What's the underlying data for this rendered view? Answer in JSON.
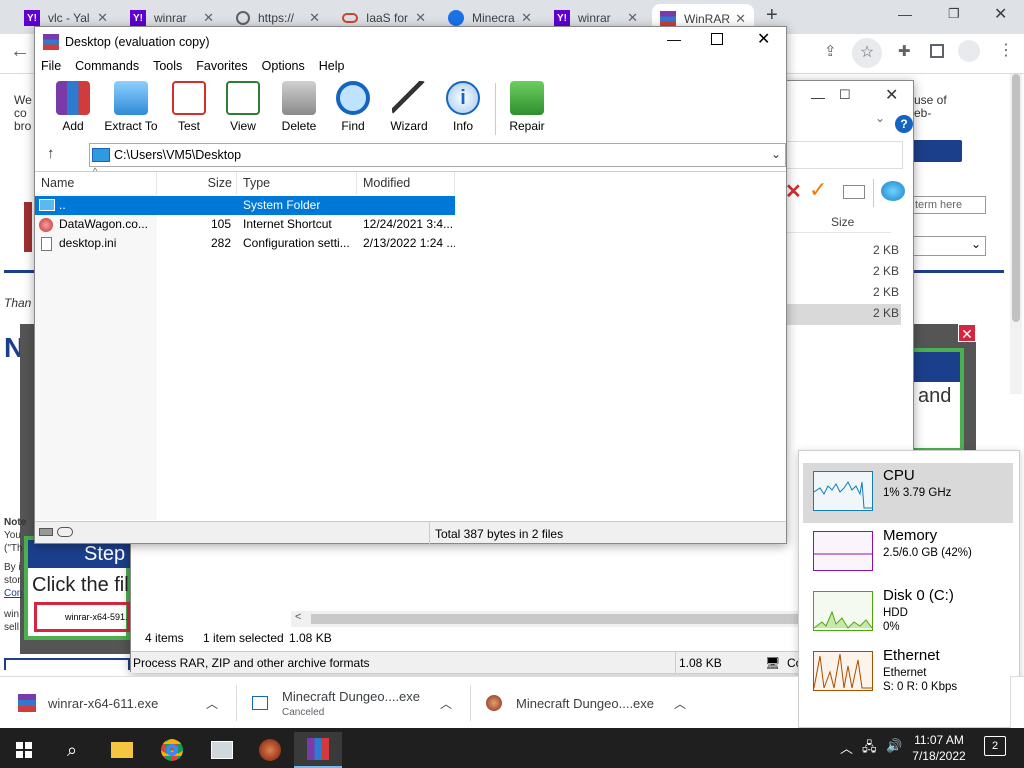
{
  "browser": {
    "tabs": [
      {
        "label": "vlc - Yal",
        "icon": "yahoo-icon"
      },
      {
        "label": "winrar",
        "icon": "yahoo-icon"
      },
      {
        "label": "https://",
        "icon": "globe-icon"
      },
      {
        "label": "IaaS for",
        "icon": "oracle-icon"
      },
      {
        "label": "Minecra",
        "icon": "edge-icon"
      },
      {
        "label": "winrar",
        "icon": "yahoo-icon"
      },
      {
        "label": "WinRAR",
        "icon": "winrar-icon"
      }
    ],
    "new_tab": "+"
  },
  "page_behind": {
    "left_texts": [
      "We",
      "co",
      "bro",
      "Than",
      "No"
    ],
    "side_texts": [
      "use of",
      "eb-"
    ],
    "search_placeholder": "term here",
    "promo_and": "and",
    "promo_e": "e",
    "step_title": "Step",
    "step_text": "Click the fil",
    "download_chip": "winrar-x64-591.e",
    "note_texts": [
      "Note",
      "You",
      "(\"Th",
      "By i",
      "stor",
      "Con",
      "win",
      "sell"
    ]
  },
  "winrar_main": {
    "title": "Desktop (evaluation copy)",
    "menu": [
      "File",
      "Commands",
      "Tools",
      "Favorites",
      "Options",
      "Help"
    ],
    "tools": [
      "Add",
      "Extract To",
      "Test",
      "View",
      "Delete",
      "Find",
      "Wizard",
      "Info",
      "Repair"
    ],
    "path": "C:\\Users\\VM5\\Desktop",
    "columns": [
      "Name",
      "Size",
      "Type",
      "Modified"
    ],
    "rows": [
      {
        "name": "..",
        "size": "",
        "type": "System Folder",
        "modified": ""
      },
      {
        "name": "DataWagon.co...",
        "size": "105",
        "type": "Internet Shortcut",
        "modified": "12/24/2021 3:4..."
      },
      {
        "name": "desktop.ini",
        "size": "282",
        "type": "Configuration setti...",
        "modified": "2/13/2022 1:24 ..."
      }
    ],
    "status": "Total 387 bytes in 2 files"
  },
  "winrar_back": {
    "size_header": "Size",
    "sizes": [
      "2 KB",
      "2 KB",
      "2 KB",
      "2 KB"
    ],
    "items_count": "4 items",
    "selected": "1 item selected",
    "selected_size": "1.08 KB",
    "status_left": "Process RAR, ZIP and other archive formats",
    "status_size": "1.08 KB",
    "status_right": "Co"
  },
  "task_manager": [
    {
      "name": "CPU",
      "line1": "1%  3.79 GHz",
      "line2": "",
      "color": "#117dbb"
    },
    {
      "name": "Memory",
      "line1": "2.5/6.0 GB (42%)",
      "line2": "",
      "color": "#8b12ae"
    },
    {
      "name": "Disk 0 (C:)",
      "line1": "HDD",
      "line2": "0%",
      "color": "#4da60c"
    },
    {
      "name": "Ethernet",
      "line1": "Ethernet",
      "line2": "S: 0  R: 0 Kbps",
      "color": "#a74f01"
    }
  ],
  "downloads": [
    {
      "name": "winrar-x64-611.exe",
      "sub": ""
    },
    {
      "name": "Minecraft Dungeo....exe",
      "sub": "Canceled"
    },
    {
      "name": "Minecraft Dungeo....exe",
      "sub": ""
    }
  ],
  "taskbar": {
    "time": "11:07 AM",
    "date": "7/18/2022",
    "notif_count": "2"
  }
}
